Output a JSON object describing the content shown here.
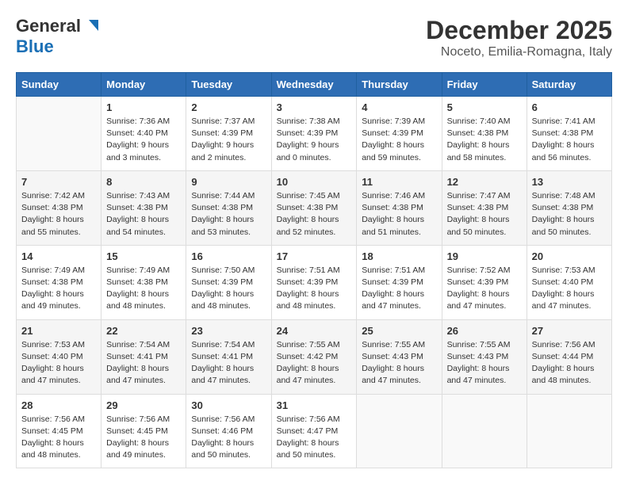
{
  "logo": {
    "line1": "General",
    "line2": "Blue"
  },
  "title": "December 2025",
  "location": "Noceto, Emilia-Romagna, Italy",
  "days_of_week": [
    "Sunday",
    "Monday",
    "Tuesday",
    "Wednesday",
    "Thursday",
    "Friday",
    "Saturday"
  ],
  "weeks": [
    [
      {
        "num": "",
        "info": ""
      },
      {
        "num": "1",
        "info": "Sunrise: 7:36 AM\nSunset: 4:40 PM\nDaylight: 9 hours\nand 3 minutes."
      },
      {
        "num": "2",
        "info": "Sunrise: 7:37 AM\nSunset: 4:39 PM\nDaylight: 9 hours\nand 2 minutes."
      },
      {
        "num": "3",
        "info": "Sunrise: 7:38 AM\nSunset: 4:39 PM\nDaylight: 9 hours\nand 0 minutes."
      },
      {
        "num": "4",
        "info": "Sunrise: 7:39 AM\nSunset: 4:39 PM\nDaylight: 8 hours\nand 59 minutes."
      },
      {
        "num": "5",
        "info": "Sunrise: 7:40 AM\nSunset: 4:38 PM\nDaylight: 8 hours\nand 58 minutes."
      },
      {
        "num": "6",
        "info": "Sunrise: 7:41 AM\nSunset: 4:38 PM\nDaylight: 8 hours\nand 56 minutes."
      }
    ],
    [
      {
        "num": "7",
        "info": "Sunrise: 7:42 AM\nSunset: 4:38 PM\nDaylight: 8 hours\nand 55 minutes."
      },
      {
        "num": "8",
        "info": "Sunrise: 7:43 AM\nSunset: 4:38 PM\nDaylight: 8 hours\nand 54 minutes."
      },
      {
        "num": "9",
        "info": "Sunrise: 7:44 AM\nSunset: 4:38 PM\nDaylight: 8 hours\nand 53 minutes."
      },
      {
        "num": "10",
        "info": "Sunrise: 7:45 AM\nSunset: 4:38 PM\nDaylight: 8 hours\nand 52 minutes."
      },
      {
        "num": "11",
        "info": "Sunrise: 7:46 AM\nSunset: 4:38 PM\nDaylight: 8 hours\nand 51 minutes."
      },
      {
        "num": "12",
        "info": "Sunrise: 7:47 AM\nSunset: 4:38 PM\nDaylight: 8 hours\nand 50 minutes."
      },
      {
        "num": "13",
        "info": "Sunrise: 7:48 AM\nSunset: 4:38 PM\nDaylight: 8 hours\nand 50 minutes."
      }
    ],
    [
      {
        "num": "14",
        "info": "Sunrise: 7:49 AM\nSunset: 4:38 PM\nDaylight: 8 hours\nand 49 minutes."
      },
      {
        "num": "15",
        "info": "Sunrise: 7:49 AM\nSunset: 4:38 PM\nDaylight: 8 hours\nand 48 minutes."
      },
      {
        "num": "16",
        "info": "Sunrise: 7:50 AM\nSunset: 4:39 PM\nDaylight: 8 hours\nand 48 minutes."
      },
      {
        "num": "17",
        "info": "Sunrise: 7:51 AM\nSunset: 4:39 PM\nDaylight: 8 hours\nand 48 minutes."
      },
      {
        "num": "18",
        "info": "Sunrise: 7:51 AM\nSunset: 4:39 PM\nDaylight: 8 hours\nand 47 minutes."
      },
      {
        "num": "19",
        "info": "Sunrise: 7:52 AM\nSunset: 4:39 PM\nDaylight: 8 hours\nand 47 minutes."
      },
      {
        "num": "20",
        "info": "Sunrise: 7:53 AM\nSunset: 4:40 PM\nDaylight: 8 hours\nand 47 minutes."
      }
    ],
    [
      {
        "num": "21",
        "info": "Sunrise: 7:53 AM\nSunset: 4:40 PM\nDaylight: 8 hours\nand 47 minutes."
      },
      {
        "num": "22",
        "info": "Sunrise: 7:54 AM\nSunset: 4:41 PM\nDaylight: 8 hours\nand 47 minutes."
      },
      {
        "num": "23",
        "info": "Sunrise: 7:54 AM\nSunset: 4:41 PM\nDaylight: 8 hours\nand 47 minutes."
      },
      {
        "num": "24",
        "info": "Sunrise: 7:55 AM\nSunset: 4:42 PM\nDaylight: 8 hours\nand 47 minutes."
      },
      {
        "num": "25",
        "info": "Sunrise: 7:55 AM\nSunset: 4:43 PM\nDaylight: 8 hours\nand 47 minutes."
      },
      {
        "num": "26",
        "info": "Sunrise: 7:55 AM\nSunset: 4:43 PM\nDaylight: 8 hours\nand 47 minutes."
      },
      {
        "num": "27",
        "info": "Sunrise: 7:56 AM\nSunset: 4:44 PM\nDaylight: 8 hours\nand 48 minutes."
      }
    ],
    [
      {
        "num": "28",
        "info": "Sunrise: 7:56 AM\nSunset: 4:45 PM\nDaylight: 8 hours\nand 48 minutes."
      },
      {
        "num": "29",
        "info": "Sunrise: 7:56 AM\nSunset: 4:45 PM\nDaylight: 8 hours\nand 49 minutes."
      },
      {
        "num": "30",
        "info": "Sunrise: 7:56 AM\nSunset: 4:46 PM\nDaylight: 8 hours\nand 50 minutes."
      },
      {
        "num": "31",
        "info": "Sunrise: 7:56 AM\nSunset: 4:47 PM\nDaylight: 8 hours\nand 50 minutes."
      },
      {
        "num": "",
        "info": ""
      },
      {
        "num": "",
        "info": ""
      },
      {
        "num": "",
        "info": ""
      }
    ]
  ]
}
